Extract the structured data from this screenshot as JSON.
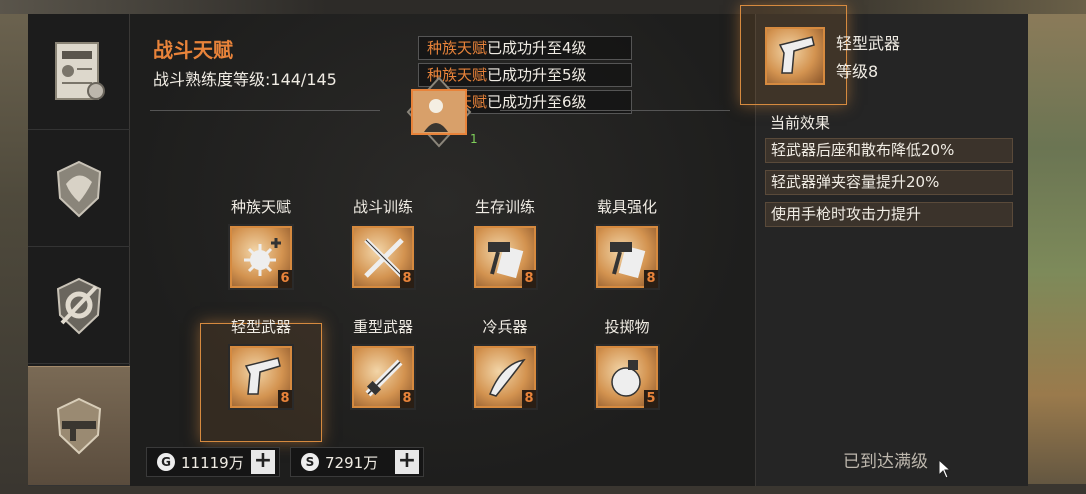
{
  "header": {
    "title": "战斗天赋",
    "proficiency_label": "战斗熟练度等级:144/145"
  },
  "notices": [
    {
      "highlight": "种族天赋",
      "text": "已成功升至4级"
    },
    {
      "highlight": "种族天赋",
      "text": "已成功升至5级"
    },
    {
      "highlight": "种族天赋",
      "text": "已成功升至6级"
    }
  ],
  "center_badge": {
    "level": "1",
    "icon": "character-icon"
  },
  "sidebar": {
    "tabs": [
      {
        "icon": "certificate-icon",
        "active": false
      },
      {
        "icon": "shield-wing-icon",
        "active": false
      },
      {
        "icon": "gear-wrench-icon",
        "active": false
      },
      {
        "icon": "rifle-icon",
        "active": true
      }
    ]
  },
  "skills": [
    {
      "label": "种族天赋",
      "level": "6",
      "icon": "virus-plus-icon"
    },
    {
      "label": "战斗训练",
      "level": "8",
      "icon": "crossed-blades-icon"
    },
    {
      "label": "生存训练",
      "level": "8",
      "icon": "hammer-paper-icon"
    },
    {
      "label": "载具强化",
      "level": "8",
      "icon": "hammer-paper-icon"
    },
    {
      "label": "轻型武器",
      "level": "8",
      "icon": "pistol-icon",
      "selected": true
    },
    {
      "label": "重型武器",
      "level": "8",
      "icon": "heavy-gun-icon"
    },
    {
      "label": "冷兵器",
      "level": "8",
      "icon": "machete-icon"
    },
    {
      "label": "投掷物",
      "level": "5",
      "icon": "grenade-icon"
    }
  ],
  "currency": [
    {
      "icon": "G",
      "value": "11119万",
      "add": "+"
    },
    {
      "icon": "S",
      "value": "7291万",
      "add": "+"
    }
  ],
  "detail": {
    "name": "轻型武器",
    "level": "等级8",
    "effects_heading": "当前效果",
    "effects": [
      "轻武器后座和散布降低20%",
      "轻武器弹夹容量提升20%",
      "使用手枪时攻击力提升"
    ],
    "status": "已到达满级"
  },
  "colors": {
    "accent": "#e8833a",
    "panel": "#232323",
    "level_green": "#7fd05a"
  }
}
